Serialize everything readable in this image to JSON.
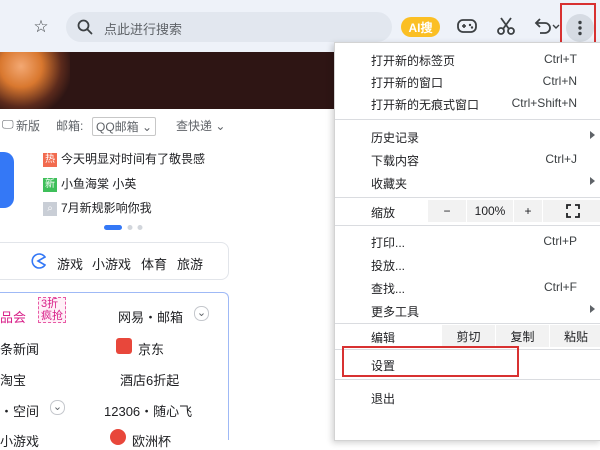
{
  "toolbar": {
    "address_placeholder": "点此进行搜索",
    "ai_label": "AI搜"
  },
  "page": {
    "links": {
      "new_version": "新版",
      "mail_label": "邮箱:",
      "mail_select": "QQ邮箱",
      "quick_check": "查快递"
    },
    "hot": [
      {
        "badge": "热",
        "badge_color": "#f26b4f",
        "text": "今天明显对时间有了敬畏感"
      },
      {
        "badge": "新",
        "badge_color": "#3fbf5a",
        "text": "小鱼海棠 小英"
      },
      {
        "badge": "",
        "badge_color": "#c9ced6",
        "text": "7月新规影响你我"
      }
    ],
    "games": [
      "游戏",
      "小游戏",
      "体育",
      "旅游"
    ],
    "sites": {
      "r1_left": "品会",
      "r1_promo_a": "3折",
      "r1_promo_b": "疯抢",
      "r1_right": "网易・邮箱",
      "r2_left": "条新闻",
      "r2_right": "京东",
      "r3_left": "淘宝",
      "r3_right": "酒店6折起",
      "r4_left": "・空间",
      "r4_right": "12306・随心飞",
      "r5_left": "小游戏",
      "r5_right": "欧洲杯"
    }
  },
  "menu": {
    "new_tab": {
      "label": "打开新的标签页",
      "shortcut": "Ctrl+T"
    },
    "new_window": {
      "label": "打开新的窗口",
      "shortcut": "Ctrl+N"
    },
    "incognito": {
      "label": "打开新的无痕式窗口",
      "shortcut": "Ctrl+Shift+N"
    },
    "history": {
      "label": "历史记录"
    },
    "downloads": {
      "label": "下载内容",
      "shortcut": "Ctrl+J"
    },
    "bookmarks": {
      "label": "收藏夹"
    },
    "zoom": {
      "label": "缩放",
      "minus": "−",
      "value": "100%",
      "plus": "+"
    },
    "print": {
      "label": "打印...",
      "shortcut": "Ctrl+P"
    },
    "cast": {
      "label": "投放..."
    },
    "find": {
      "label": "查找...",
      "shortcut": "Ctrl+F"
    },
    "more_tools": {
      "label": "更多工具"
    },
    "edit": {
      "label": "编辑",
      "cut": "剪切",
      "copy": "复制",
      "paste": "粘贴"
    },
    "settings": {
      "label": "设置"
    },
    "exit": {
      "label": "退出"
    }
  },
  "colors": {
    "highlight": "#d83131",
    "toolbar_bg": "#eef2f9",
    "ai_badge": "#fbbf24"
  }
}
